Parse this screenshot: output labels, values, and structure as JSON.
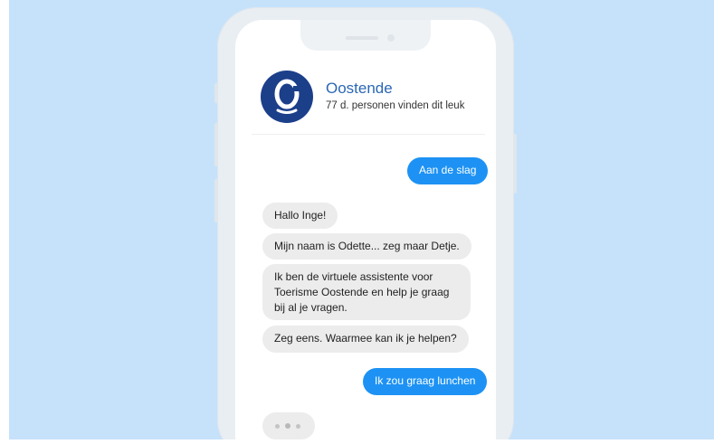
{
  "chat": {
    "name": "Oostende",
    "likes": "77 d. personen vinden dit leuk",
    "messages": [
      {
        "from": "user",
        "text": "Aan de slag"
      },
      {
        "from": "bot",
        "text": "Hallo Inge!"
      },
      {
        "from": "bot",
        "text": "Mijn naam is Odette... zeg maar Detje."
      },
      {
        "from": "bot",
        "text": "Ik ben de virtuele assistente voor\nToerisme Oostende en help je graag\nbij al je vragen."
      },
      {
        "from": "bot",
        "text": "Zeg eens. Waarmee kan ik je helpen?"
      },
      {
        "from": "user",
        "text": "Ik zou graag lunchen"
      }
    ]
  },
  "colors": {
    "background": "#c6e2fb",
    "user_bubble": "#1d92f4",
    "bot_bubble": "#ececec",
    "brand": "#1c3f8a"
  }
}
